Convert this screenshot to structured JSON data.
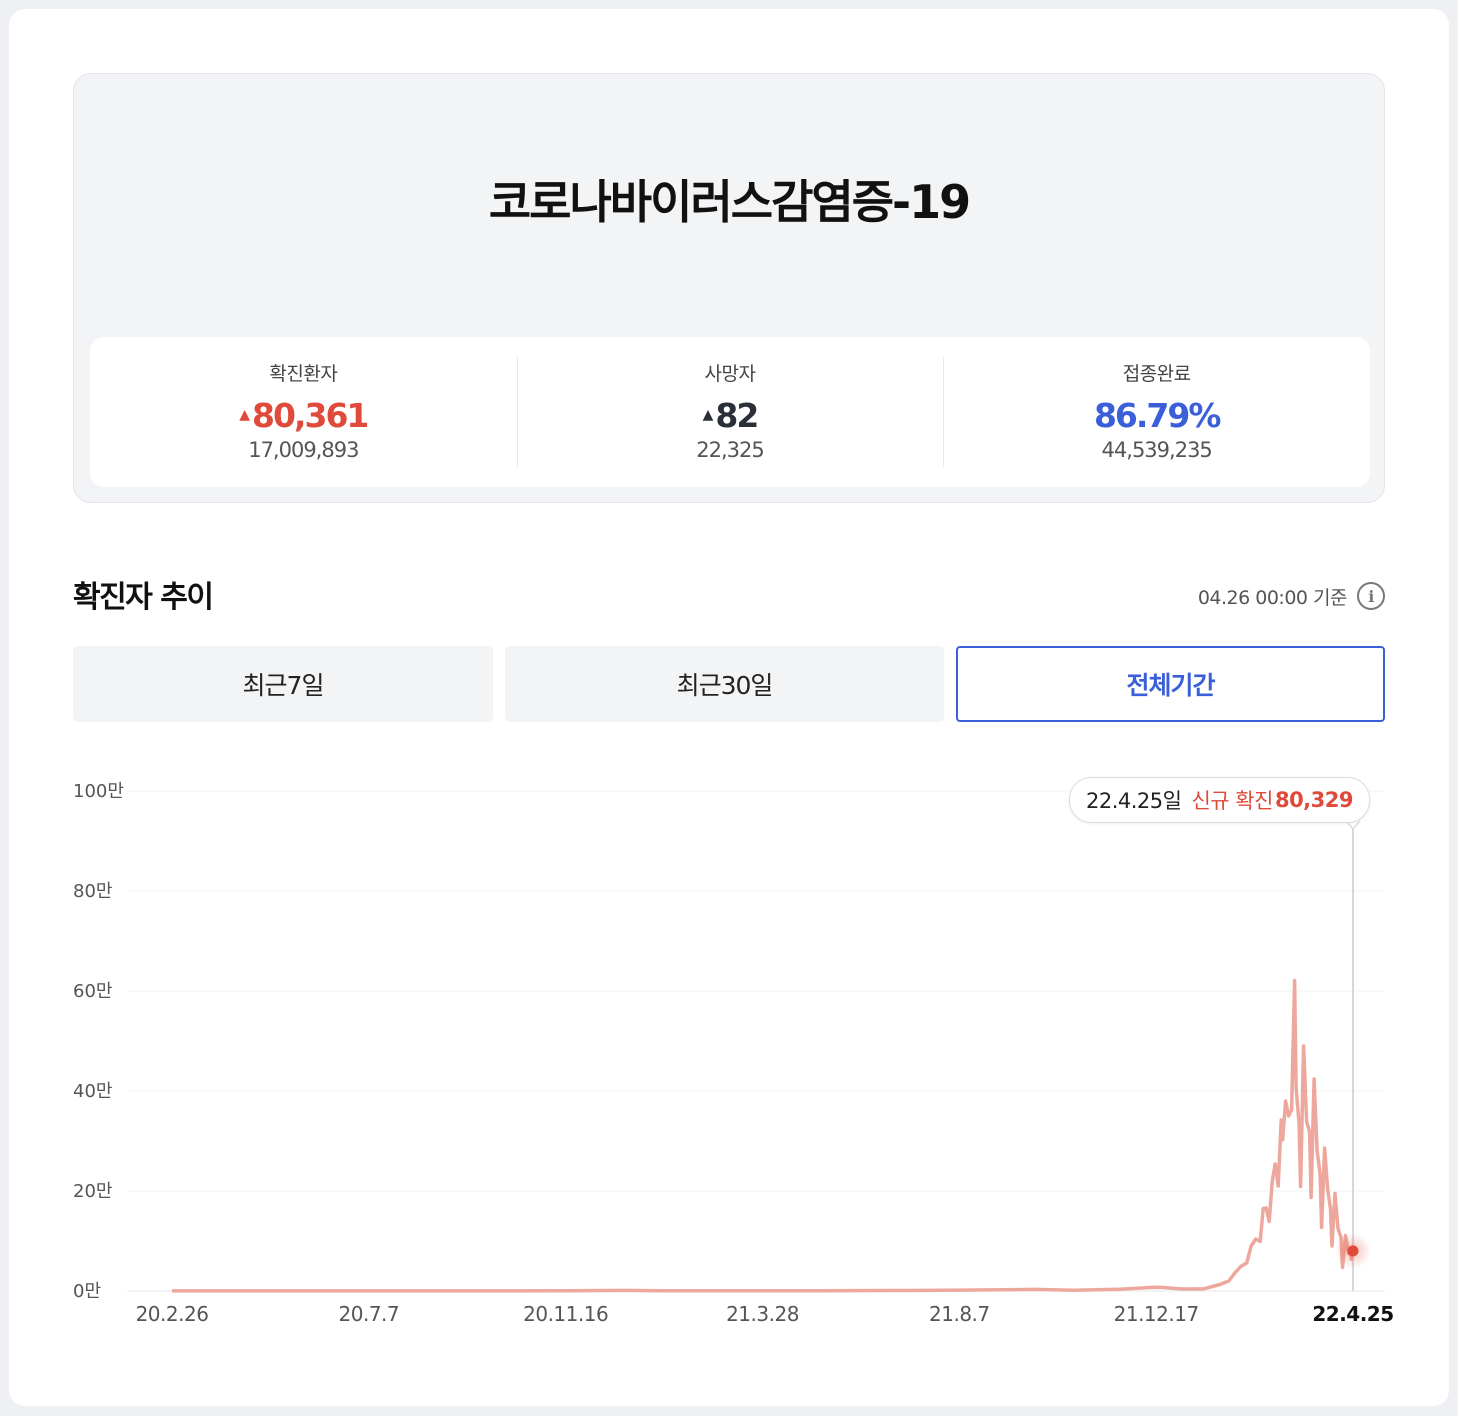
{
  "summary": {
    "title": "코로나바이러스감염증-19",
    "stats": [
      {
        "label": "확진환자",
        "main": "80,361",
        "sub": "17,009,893",
        "arrow": "▲",
        "color": "#e04a3a"
      },
      {
        "label": "사망자",
        "main": "82",
        "sub": "22,325",
        "arrow": "▲",
        "color": "#2b2f3a"
      },
      {
        "label": "접종완료",
        "main": "86.79%",
        "sub": "44,539,235",
        "arrow": "",
        "color": "#3a5fd8"
      }
    ]
  },
  "trend": {
    "title": "확진자 추이",
    "basis": "04.26 00:00 기준",
    "info_icon": "info-icon",
    "tabs": [
      {
        "label": "최근7일",
        "active": false
      },
      {
        "label": "최근30일",
        "active": false
      },
      {
        "label": "전체기간",
        "active": true
      }
    ]
  },
  "tooltip": {
    "date": "22.4.25일",
    "label": "신규 확진",
    "value": "80,329"
  },
  "colors": {
    "accent": "#3a5fd8",
    "red": "#e04a3a",
    "line": "#eea79c"
  },
  "chart_data": {
    "type": "line",
    "y_ticks": [
      "100만",
      "80만",
      "60만",
      "40만",
      "20만",
      "0만"
    ],
    "y_tick_values": [
      1000000,
      800000,
      600000,
      400000,
      200000,
      0
    ],
    "ylim": [
      0,
      1000000
    ],
    "x_ticks": [
      "20.2.26",
      "20.7.7",
      "20.11.16",
      "21.3.28",
      "21.8.7",
      "21.12.17",
      "22.4.25"
    ],
    "x_range": [
      "2020-02-26",
      "2022-04-25"
    ],
    "series": [
      {
        "values": [
          [
            "2020-02-26",
            300
          ],
          [
            "2020-04-01",
            300
          ],
          [
            "2020-07-07",
            200
          ],
          [
            "2020-09-01",
            300
          ],
          [
            "2020-11-16",
            500
          ],
          [
            "2020-12-25",
            1200
          ],
          [
            "2021-01-20",
            600
          ],
          [
            "2021-03-28",
            500
          ],
          [
            "2021-05-01",
            600
          ],
          [
            "2021-07-01",
            900
          ],
          [
            "2021-08-07",
            1800
          ],
          [
            "2021-09-25",
            3200
          ],
          [
            "2021-10-20",
            1500
          ],
          [
            "2021-11-20",
            3500
          ],
          [
            "2021-12-10",
            7000
          ],
          [
            "2021-12-17",
            7400
          ],
          [
            "2022-01-01",
            4000
          ],
          [
            "2022-01-15",
            4200
          ],
          [
            "2022-01-26",
            13000
          ],
          [
            "2022-02-01",
            20000
          ],
          [
            "2022-02-05",
            36000
          ],
          [
            "2022-02-09",
            49000
          ],
          [
            "2022-02-13",
            56000
          ],
          [
            "2022-02-16",
            90000
          ],
          [
            "2022-02-19",
            104000
          ],
          [
            "2022-02-22",
            99000
          ],
          [
            "2022-02-24",
            165000
          ],
          [
            "2022-02-26",
            166000
          ],
          [
            "2022-02-28",
            139000
          ],
          [
            "2022-03-02",
            219000
          ],
          [
            "2022-03-04",
            254000
          ],
          [
            "2022-03-06",
            210000
          ],
          [
            "2022-03-08",
            342000
          ],
          [
            "2022-03-09",
            302000
          ],
          [
            "2022-03-11",
            380000
          ],
          [
            "2022-03-13",
            350000
          ],
          [
            "2022-03-15",
            362000
          ],
          [
            "2022-03-17",
            621000
          ],
          [
            "2022-03-18",
            407000
          ],
          [
            "2022-03-20",
            334000
          ],
          [
            "2022-03-21",
            209000
          ],
          [
            "2022-03-23",
            490000
          ],
          [
            "2022-03-25",
            339000
          ],
          [
            "2022-03-27",
            318000
          ],
          [
            "2022-03-28",
            187000
          ],
          [
            "2022-03-30",
            424000
          ],
          [
            "2022-04-01",
            280000
          ],
          [
            "2022-04-03",
            234000
          ],
          [
            "2022-04-04",
            127000
          ],
          [
            "2022-04-06",
            286000
          ],
          [
            "2022-04-08",
            205000
          ],
          [
            "2022-04-10",
            164000
          ],
          [
            "2022-04-11",
            90000
          ],
          [
            "2022-04-13",
            195000
          ],
          [
            "2022-04-15",
            125000
          ],
          [
            "2022-04-17",
            107000
          ],
          [
            "2022-04-18",
            47000
          ],
          [
            "2022-04-20",
            111000
          ],
          [
            "2022-04-22",
            75000
          ],
          [
            "2022-04-23",
            81000
          ],
          [
            "2022-04-24",
            64000
          ],
          [
            "2022-04-25",
            80329
          ]
        ]
      }
    ],
    "highlight": [
      "2022-04-25",
      80329
    ],
    "grid": true
  }
}
